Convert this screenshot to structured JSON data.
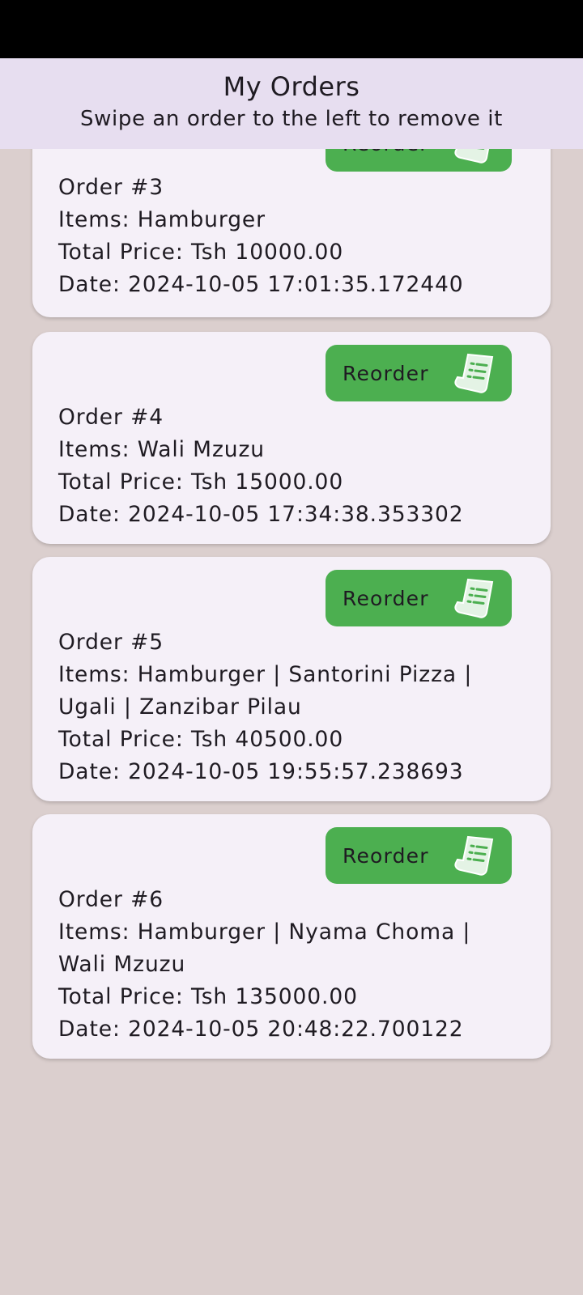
{
  "app_bar": {
    "title": "My Orders",
    "subtitle": "Swipe an order to the left to remove it"
  },
  "orders": [
    {
      "reorder_label": "Reorder",
      "number": "Order #3",
      "items": "Items: Hamburger",
      "price": "Total Price: Tsh 10000.00",
      "date": "Date: 2024-10-05 17:01:35.172440"
    },
    {
      "reorder_label": "Reorder",
      "number": "Order #4",
      "items": "Items: Wali Mzuzu",
      "price": "Total Price: Tsh 15000.00",
      "date": "Date: 2024-10-05 17:34:38.353302"
    },
    {
      "reorder_label": "Reorder",
      "number": "Order #5",
      "items_line1": "Items: Hamburger | Santorini Pizza |",
      "items_line2": "Ugali | Zanzibar Pilau",
      "price": "Total Price: Tsh 40500.00",
      "date": "Date: 2024-10-05 19:55:57.238693"
    },
    {
      "reorder_label": "Reorder",
      "number": "Order #6",
      "items_line1": "Items: Hamburger | Nyama Choma |",
      "items_line2": "Wali Mzuzu",
      "price": "Total Price: Tsh 135000.00",
      "date": "Date: 2024-10-05 20:48:22.700122"
    }
  ],
  "colors": {
    "background": "#dbcfce",
    "app_bar": "#e7def0",
    "card": "#f5f0f8",
    "reorder_button": "#4caf50",
    "text": "#1f1b22"
  },
  "icons": {
    "reorder": "receipt-long-icon"
  }
}
